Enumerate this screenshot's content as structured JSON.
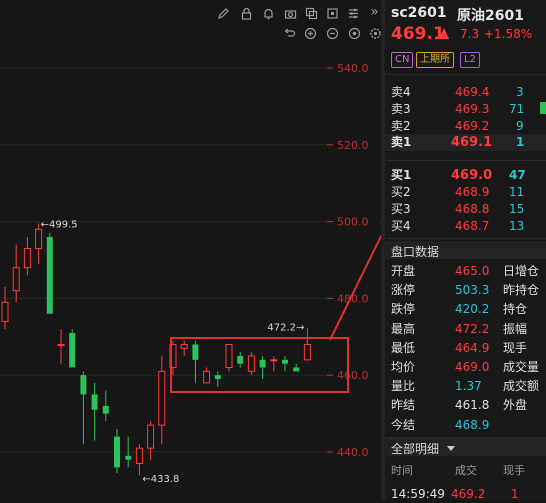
{
  "symbol": {
    "code": "sc2601",
    "name": "原油2601",
    "price": "469.1",
    "change": "7.3",
    "change_pct": "+1.58%"
  },
  "tags": {
    "cn": "CN",
    "exchange": "上期所",
    "level": "L2"
  },
  "colors": {
    "up": "#ff3b3b",
    "down": "#2ec05a",
    "cyan": "#2cc4d8",
    "bg": "#161616"
  },
  "toolbar_icons": [
    "pen-icon",
    "lock-icon",
    "bell-icon",
    "camera-icon",
    "copy-icon",
    "layers-icon",
    "settings-icon"
  ],
  "toolbar_icons_row2": [
    "undo-icon",
    "zoom-in-icon",
    "zoom-out-icon",
    "target-icon"
  ],
  "orderbook": {
    "asks": [
      {
        "label": "卖4",
        "price": "469.4",
        "qty": "3"
      },
      {
        "label": "卖3",
        "price": "469.3",
        "qty": "71"
      },
      {
        "label": "卖2",
        "price": "469.2",
        "qty": "9"
      },
      {
        "label": "卖1",
        "price": "469.1",
        "qty": "1"
      }
    ],
    "bids": [
      {
        "label": "买1",
        "price": "469.0",
        "qty": "47"
      },
      {
        "label": "买2",
        "price": "468.9",
        "qty": "11"
      },
      {
        "label": "买3",
        "price": "468.8",
        "qty": "15"
      },
      {
        "label": "买4",
        "price": "468.7",
        "qty": "13"
      }
    ]
  },
  "stats": {
    "title": "盘口数据",
    "rows": [
      {
        "label": "开盘",
        "value": "465.0",
        "right": "日增仓",
        "color": "red"
      },
      {
        "label": "涨停",
        "value": "503.3",
        "right": "昨持仓",
        "color": "cyan"
      },
      {
        "label": "跌停",
        "value": "420.2",
        "right": "持仓",
        "color": "cyan"
      },
      {
        "label": "最高",
        "value": "472.2",
        "right": "振幅",
        "color": "red"
      },
      {
        "label": "最低",
        "value": "464.9",
        "right": "现手",
        "color": "red"
      },
      {
        "label": "均价",
        "value": "469.0",
        "right": "成交量",
        "color": "red"
      },
      {
        "label": "量比",
        "value": "1.37",
        "right": "成交额",
        "color": "cyan"
      },
      {
        "label": "昨结",
        "value": "461.8",
        "right": "外盘",
        "color": "white"
      },
      {
        "label": "今结",
        "value": "468.9",
        "right": "",
        "color": "cyan"
      }
    ]
  },
  "trades": {
    "title": "全部明细",
    "headers": [
      "时间",
      "成交",
      "现手"
    ],
    "rows": [
      {
        "time": "14:59:49",
        "price": "469.2",
        "qty": "1"
      }
    ]
  },
  "chart_data": {
    "type": "candlestick",
    "y_ticks": [
      "540.0",
      "520.0",
      "500.0",
      "480.0",
      "460.0",
      "440.0"
    ],
    "ylim": [
      434.4,
      541.7
    ],
    "candles": [
      {
        "o": 474,
        "h": 483,
        "l": 472,
        "c": 479
      },
      {
        "o": 482,
        "h": 494,
        "l": 479,
        "c": 488
      },
      {
        "o": 488,
        "h": 496,
        "l": 486,
        "c": 493
      },
      {
        "o": 493,
        "h": 499.5,
        "l": 489,
        "c": 498
      },
      {
        "o": 496,
        "h": 497,
        "l": 476,
        "c": 476
      },
      {
        "o": 468,
        "h": 472,
        "l": 463,
        "c": 468
      },
      {
        "o": 471,
        "h": 472,
        "l": 462,
        "c": 462
      },
      {
        "o": 460,
        "h": 461,
        "l": 442,
        "c": 455
      },
      {
        "o": 455,
        "h": 458,
        "l": 443,
        "c": 451
      },
      {
        "o": 452,
        "h": 456,
        "l": 448,
        "c": 450
      },
      {
        "o": 444,
        "h": 446,
        "l": 434.5,
        "c": 436
      },
      {
        "o": 439,
        "h": 444,
        "l": 436,
        "c": 438
      },
      {
        "o": 437,
        "h": 442,
        "l": 433.8,
        "c": 441
      },
      {
        "o": 441,
        "h": 448,
        "l": 438,
        "c": 447
      },
      {
        "o": 447,
        "h": 465,
        "l": 442,
        "c": 461
      },
      {
        "o": 462,
        "h": 469,
        "l": 460,
        "c": 468
      },
      {
        "o": 467,
        "h": 469,
        "l": 465,
        "c": 468
      },
      {
        "o": 468,
        "h": 469,
        "l": 458,
        "c": 464
      },
      {
        "o": 458,
        "h": 462,
        "l": 458,
        "c": 461
      },
      {
        "o": 460,
        "h": 461,
        "l": 457,
        "c": 459
      },
      {
        "o": 462,
        "h": 468,
        "l": 461,
        "c": 468
      },
      {
        "o": 465,
        "h": 466,
        "l": 462,
        "c": 463
      },
      {
        "o": 461,
        "h": 466,
        "l": 460,
        "c": 465
      },
      {
        "o": 464,
        "h": 465,
        "l": 459,
        "c": 462
      },
      {
        "o": 464,
        "h": 465,
        "l": 461,
        "c": 464
      },
      {
        "o": 464,
        "h": 465,
        "l": 461,
        "c": 463
      },
      {
        "o": 462,
        "h": 463,
        "l": 461,
        "c": 461
      },
      {
        "o": 464,
        "h": 472.2,
        "l": 464,
        "c": 468
      }
    ],
    "annotations": [
      {
        "text": "←499.5",
        "value": 499.5
      },
      {
        "text": "←433.8",
        "value": 433.8
      },
      {
        "text": "472.2→",
        "value": 472.2
      }
    ]
  }
}
